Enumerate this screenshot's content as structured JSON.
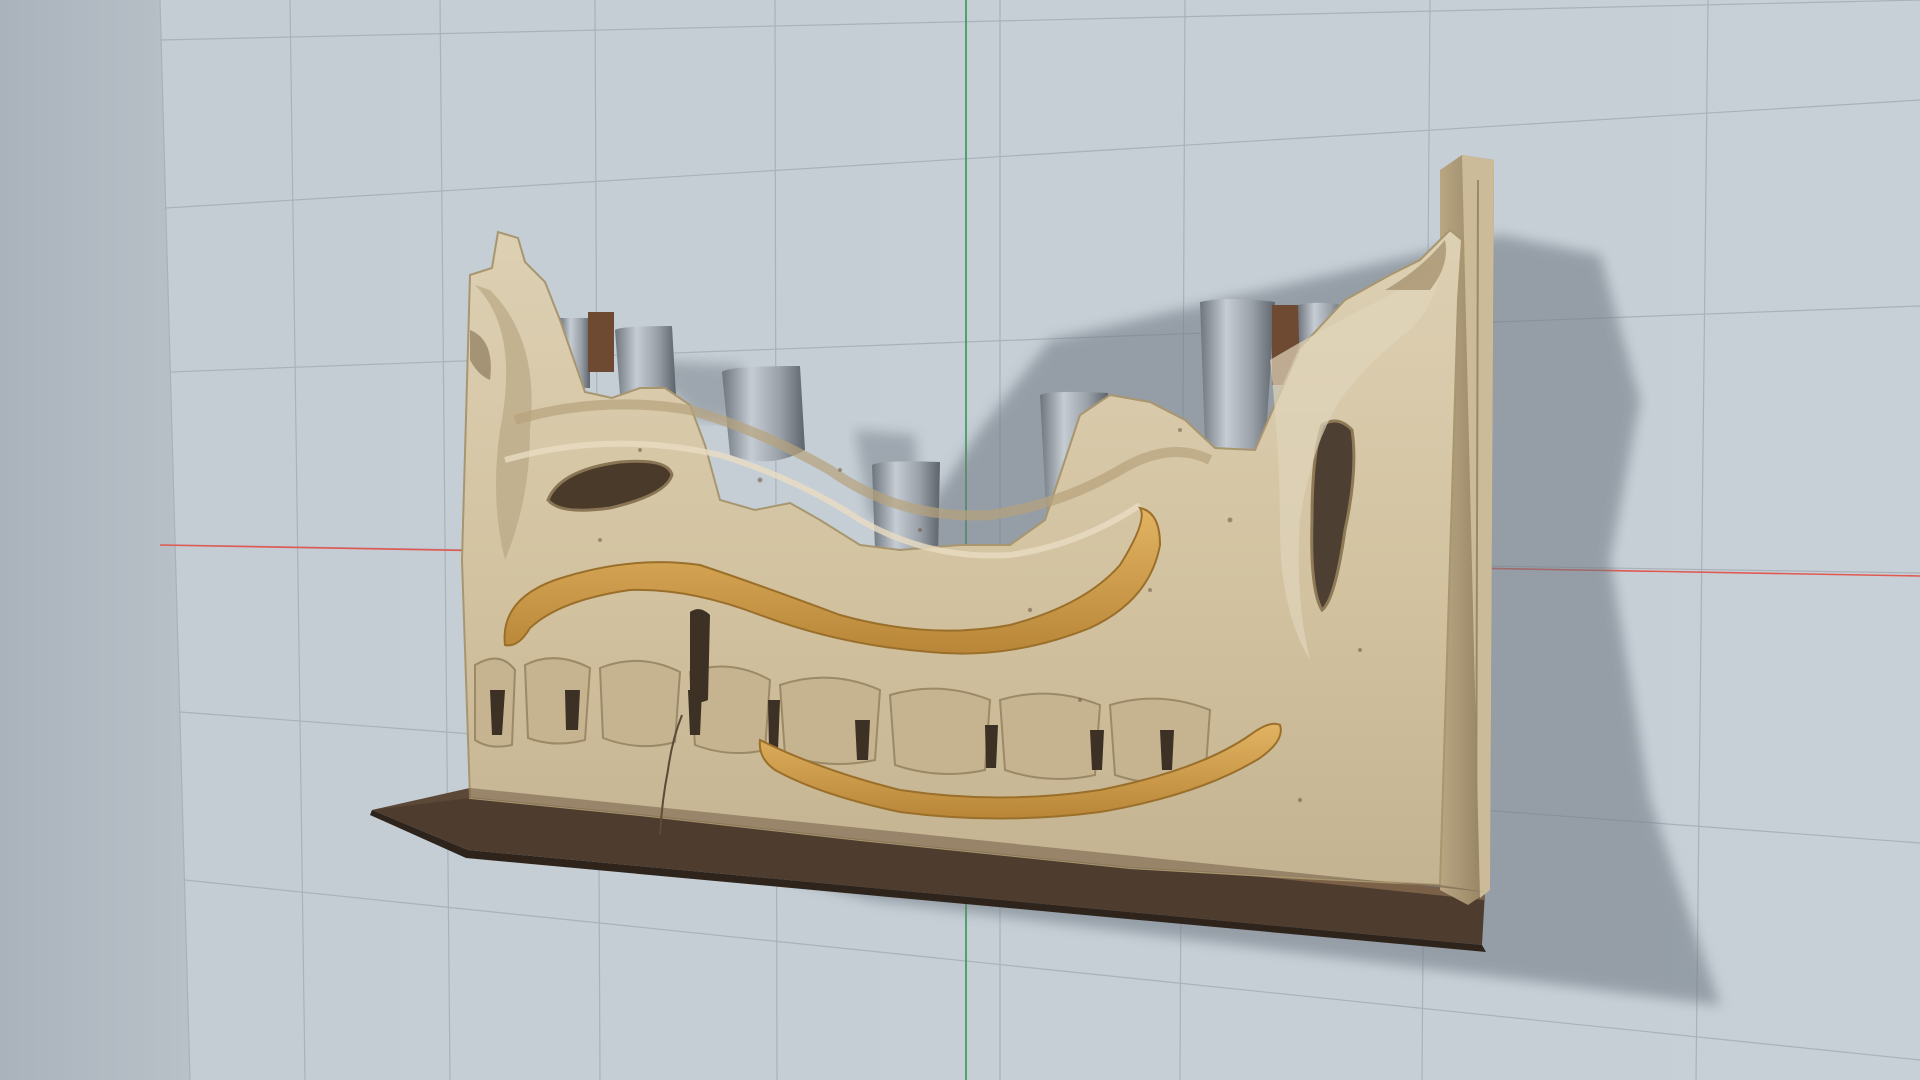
{
  "viewport": {
    "mode": "3d-perspective",
    "background_color": "#b3bcc4",
    "wall_color": "#c2cad2",
    "grid_line_color": "#a9b2ba",
    "axis_x_color": "#e05a52",
    "axis_y_color": "#2f9a4a"
  },
  "model": {
    "object": "carved-scroll-panel-with-pipes",
    "wood_light_color": "#d8c8a8",
    "wood_mid_color": "#c2b08c",
    "wood_dark_color": "#7d6a4c",
    "ochre_band_color": "#d19d48",
    "pipe_color": "#a3a9b1",
    "base_color": "#5a4636"
  }
}
